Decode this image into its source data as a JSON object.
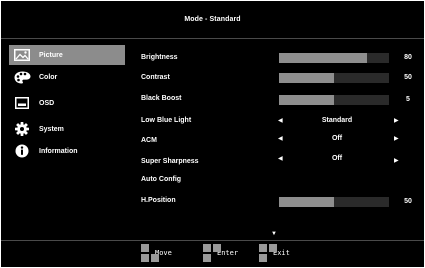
{
  "header": {
    "title": "Mode - Standard"
  },
  "sidebar": {
    "items": [
      {
        "label": "Picture",
        "icon": "picture-icon",
        "active": true
      },
      {
        "label": "Color",
        "icon": "palette-icon"
      },
      {
        "label": "OSD",
        "icon": "osd-window-icon"
      },
      {
        "label": "System",
        "icon": "gear-icon"
      },
      {
        "label": "Information",
        "icon": "info-icon"
      }
    ]
  },
  "picture": {
    "brightness": {
      "label": "Brightness",
      "value": "80",
      "level": 80
    },
    "contrast": {
      "label": "Contrast",
      "value": "50",
      "level": 50
    },
    "black_boost": {
      "label": "Black Boost",
      "value": "5",
      "level": 50
    },
    "low_blue_light": {
      "label": "Low Blue Light",
      "value": "Standard"
    },
    "acm": {
      "label": "ACM",
      "value": "Off"
    },
    "super_sharpness": {
      "label": "Super Sharpness",
      "value": "Off"
    },
    "auto_config": {
      "label": "Auto Config"
    },
    "h_position": {
      "label": "H.Position",
      "value": "50",
      "level": 50
    }
  },
  "footer": {
    "move_label": "Move",
    "enter_label": "Enter",
    "exit_label": "Exit"
  },
  "colors": {
    "background": "#000000",
    "active_item": "#8c8c8c",
    "bar_fill": "#8e8e8e",
    "bar_track": "#2a2a2a"
  }
}
